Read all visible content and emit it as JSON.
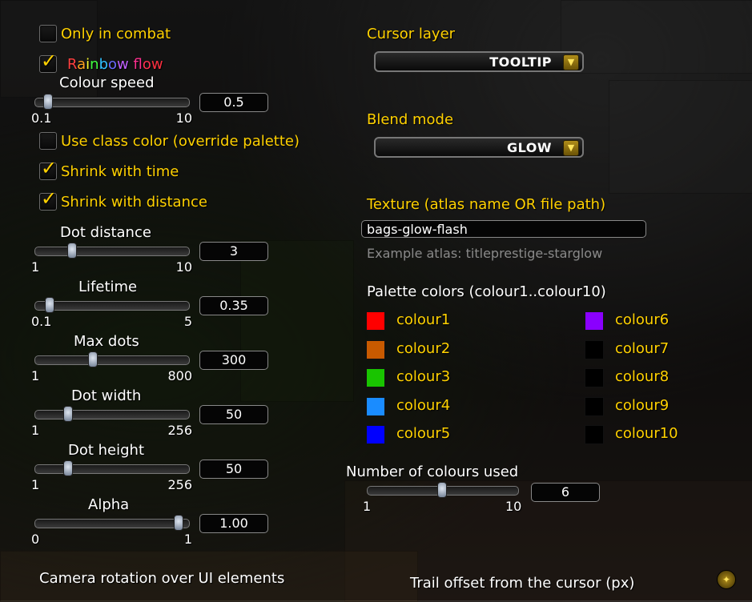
{
  "checkboxes": {
    "only_in_combat": {
      "label": "Only in combat",
      "checked": false
    },
    "rainbow_flow": {
      "checked": true,
      "letters": [
        "R",
        "a",
        "i",
        "n",
        "b",
        "o",
        "w",
        " ",
        "f",
        "l",
        "o",
        "w"
      ],
      "colors": [
        "#ff4040",
        "#ffa020",
        "#ffff30",
        "#40ff40",
        "#30c0ff",
        "#6a6aff",
        "#c060ff",
        "#ffffff",
        "#ff3090",
        "#ff3070",
        "#ff3050",
        "#ff3040"
      ]
    },
    "use_class_color": {
      "label": "Use class color (override palette)",
      "checked": false
    },
    "shrink_with_time": {
      "label": "Shrink with time",
      "checked": true
    },
    "shrink_with_distance": {
      "label": "Shrink with distance",
      "checked": true
    }
  },
  "sliders": [
    {
      "key": "colour_speed",
      "label": "Colour speed",
      "min_label": "0.1",
      "max_label": "10",
      "value": "0.5",
      "fraction": 0.04
    },
    {
      "key": "dot_distance",
      "label": "Dot distance",
      "min_label": "1",
      "max_label": "10",
      "value": "3",
      "fraction": 0.22
    },
    {
      "key": "lifetime",
      "label": "Lifetime",
      "min_label": "0.1",
      "max_label": "5",
      "value": "0.35",
      "fraction": 0.05
    },
    {
      "key": "max_dots",
      "label": "Max dots",
      "min_label": "1",
      "max_label": "800",
      "value": "300",
      "fraction": 0.37
    },
    {
      "key": "dot_width",
      "label": "Dot width",
      "min_label": "1",
      "max_label": "256",
      "value": "50",
      "fraction": 0.19
    },
    {
      "key": "dot_height",
      "label": "Dot height",
      "min_label": "1",
      "max_label": "256",
      "value": "50",
      "fraction": 0.19
    },
    {
      "key": "alpha",
      "label": "Alpha",
      "min_label": "0",
      "max_label": "1",
      "value": "1.00",
      "fraction": 1.0
    }
  ],
  "cursor_layer": {
    "label": "Cursor layer",
    "value": "TOOLTIP"
  },
  "blend_mode": {
    "label": "Blend mode",
    "value": "GLOW"
  },
  "texture": {
    "label": "Texture (atlas name OR file path)",
    "value": "bags-glow-flash",
    "hint": "Example atlas: titleprestige-starglow"
  },
  "palette": {
    "title": "Palette colors (colour1..colour10)",
    "colours": [
      {
        "name": "colour1",
        "color": "#ff0000"
      },
      {
        "name": "colour2",
        "color": "#c85a00"
      },
      {
        "name": "colour3",
        "color": "#19c400"
      },
      {
        "name": "colour4",
        "color": "#1a8cff"
      },
      {
        "name": "colour5",
        "color": "#0000ff"
      },
      {
        "name": "colour6",
        "color": "#8a00ff"
      },
      {
        "name": "colour7",
        "color": "#000000"
      },
      {
        "name": "colour8",
        "color": "#000000"
      },
      {
        "name": "colour9",
        "color": "#000000"
      },
      {
        "name": "colour10",
        "color": "#000000"
      }
    ]
  },
  "num_colours": {
    "label": "Number of colours used",
    "min_label": "1",
    "max_label": "10",
    "value": "6",
    "fraction": 0.5
  },
  "footer": {
    "camera_rotation": "Camera rotation over UI elements",
    "trail_offset": "Trail offset from the cursor (px)"
  },
  "icons": {
    "checkmark": "checkmark-icon",
    "dropdown_arrow": "arrow-down-icon",
    "corner": "minimap-button-icon"
  },
  "accent_gold": "#ffd100"
}
